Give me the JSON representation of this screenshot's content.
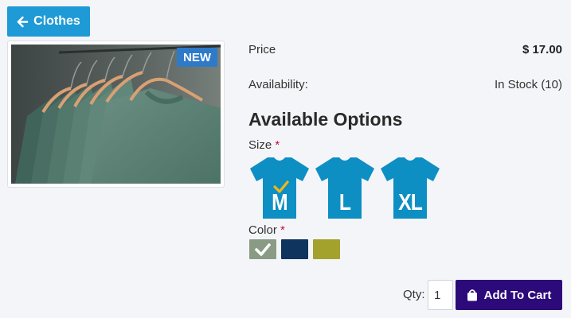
{
  "nav": {
    "back_label": "Clothes",
    "back_icon": "arrow-left-icon"
  },
  "product": {
    "badge": "NEW",
    "image_subject": "t-shirts on hangers"
  },
  "details": {
    "price_label": "Price",
    "price_value": "$ 17.00",
    "availability_label": "Availability:",
    "availability_value": "In Stock (10)"
  },
  "options": {
    "title": "Available Options",
    "size_label": "Size",
    "required_marker": "*",
    "sizes": [
      {
        "label": "M",
        "selected": true
      },
      {
        "label": "L",
        "selected": false
      },
      {
        "label": "XL",
        "selected": false
      }
    ],
    "color_label": "Color",
    "colors": [
      {
        "hex": "#8a9b85",
        "selected": true
      },
      {
        "hex": "#0f355e",
        "selected": false
      },
      {
        "hex": "#a3a22c",
        "selected": false
      }
    ]
  },
  "cart": {
    "qty_label": "Qty:",
    "qty_value": "1",
    "add_label": "Add To Cart",
    "icon": "shopping-bag-icon"
  },
  "colors": {
    "back_button": "#1e9ad6",
    "badge": "#2f7ac8",
    "shirt_swatch": "#0e8fc4",
    "check": "#f2b718",
    "cart_button": "#2c0a7a",
    "required": "#c8102e"
  }
}
